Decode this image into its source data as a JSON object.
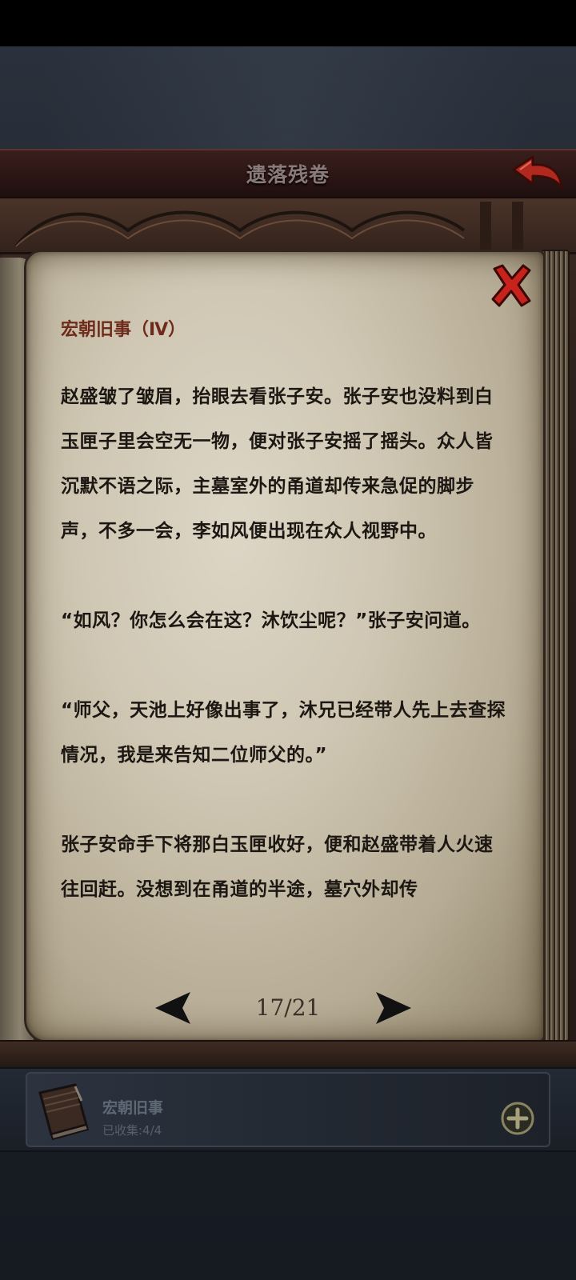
{
  "header": {
    "title": "遗落残卷"
  },
  "reader": {
    "chapter_title": "宏朝旧事（Ⅳ）",
    "paragraphs": [
      "赵盛皱了皱眉，抬眼去看张子安。张子安也没料到白玉匣子里会空无一物，便对张子安摇了摇头。众人皆沉默不语之际，主墓室外的甬道却传来急促的脚步声，不多一会，李如风便出现在众人视野中。",
      "“如风？你怎么会在这？沐饮尘呢？”张子安问道。",
      "“师父，天池上好像出事了，沐兄已经带人先上去查探情况，我是来告知二位师父的。”",
      "张子安命手下将那白玉匣收好，便和赵盛带着人火速往回赶。没想到在甬道的半途，墓穴外却传"
    ],
    "page_indicator": "17/21",
    "current_page": 17,
    "total_pages": 21
  },
  "collection": {
    "name": "宏朝旧事",
    "collected_label": "已收集:4/4",
    "collected": 4,
    "total": 4
  },
  "icons": {
    "back": "back-arrow-icon",
    "close": "close-x-icon",
    "prev": "prev-page-arrow-icon",
    "next": "next-page-arrow-icon",
    "book": "book-icon",
    "add": "plus-circle-icon"
  },
  "colors": {
    "header_title": "#8a7a78",
    "chapter_title": "#6e2a1a",
    "body_text": "#1c1712",
    "close_red": "#c8221c",
    "back_red": "#b0281e"
  }
}
